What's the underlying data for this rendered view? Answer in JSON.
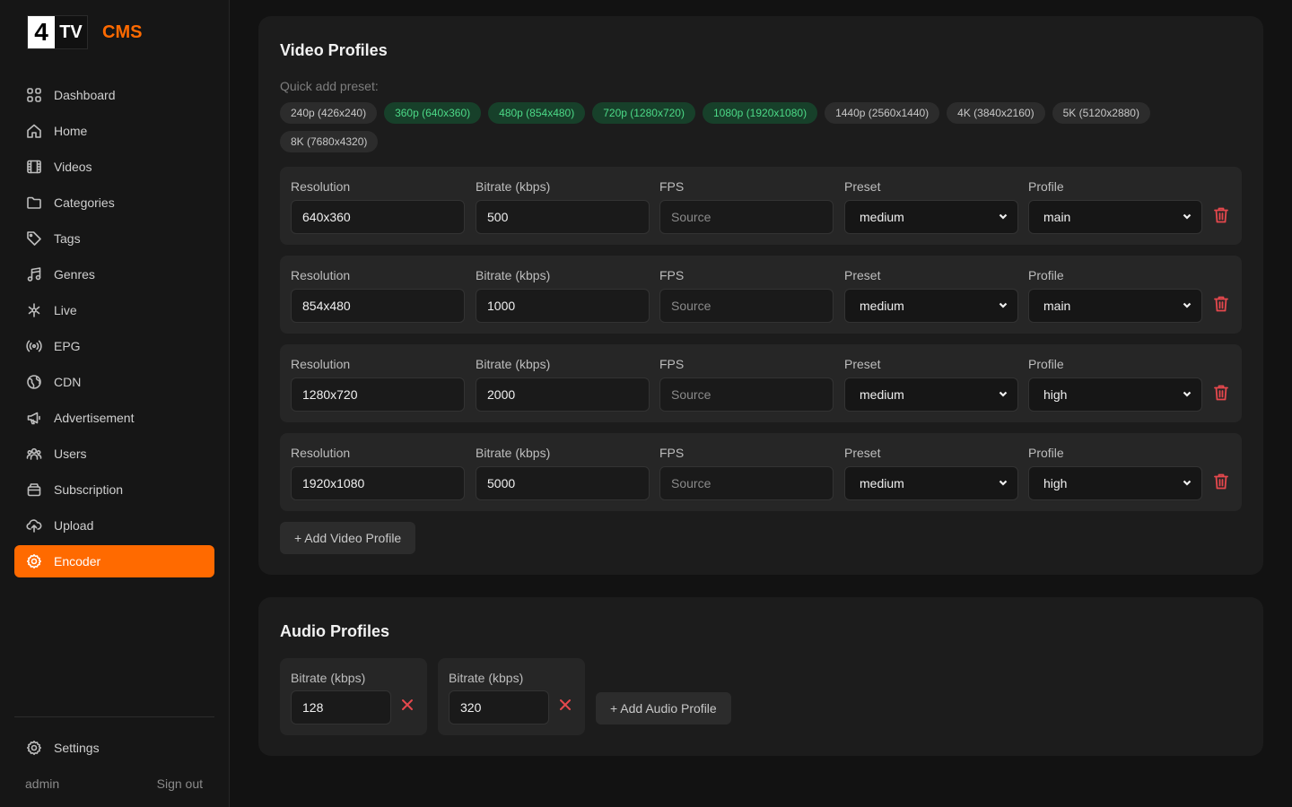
{
  "brand": {
    "logo_num": "4",
    "logo_tv": "TV",
    "logo_cms": "CMS",
    "accent": "#ff6a00"
  },
  "sidebar": {
    "items": [
      {
        "label": "Dashboard",
        "icon": "dashboard-icon"
      },
      {
        "label": "Home",
        "icon": "home-icon"
      },
      {
        "label": "Videos",
        "icon": "film-icon"
      },
      {
        "label": "Categories",
        "icon": "folder-icon"
      },
      {
        "label": "Tags",
        "icon": "tag-icon"
      },
      {
        "label": "Genres",
        "icon": "music-icon"
      },
      {
        "label": "Live",
        "icon": "live-icon"
      },
      {
        "label": "EPG",
        "icon": "broadcast-icon"
      },
      {
        "label": "CDN",
        "icon": "globe-icon"
      },
      {
        "label": "Advertisement",
        "icon": "megaphone-icon"
      },
      {
        "label": "Users",
        "icon": "users-icon"
      },
      {
        "label": "Subscription",
        "icon": "wallet-icon"
      },
      {
        "label": "Upload",
        "icon": "upload-icon"
      },
      {
        "label": "Encoder",
        "icon": "gear-icon",
        "active": true
      }
    ],
    "settings_label": "Settings",
    "user": "admin",
    "signout_label": "Sign out"
  },
  "video": {
    "title": "Video Profiles",
    "quick_label": "Quick add preset:",
    "presets": [
      {
        "label": "240p (426x240)",
        "added": false
      },
      {
        "label": "360p (640x360)",
        "added": true
      },
      {
        "label": "480p (854x480)",
        "added": true
      },
      {
        "label": "720p (1280x720)",
        "added": true
      },
      {
        "label": "1080p (1920x1080)",
        "added": true
      },
      {
        "label": "1440p (2560x1440)",
        "added": false
      },
      {
        "label": "4K (3840x2160)",
        "added": false
      },
      {
        "label": "5K (5120x2880)",
        "added": false
      },
      {
        "label": "8K (7680x4320)",
        "added": false
      }
    ],
    "labels": {
      "resolution": "Resolution",
      "bitrate": "Bitrate (kbps)",
      "fps": "FPS",
      "preset": "Preset",
      "profile": "Profile"
    },
    "fps_placeholder": "Source",
    "profiles": [
      {
        "resolution": "640x360",
        "bitrate": "500",
        "preset": "medium",
        "profile": "main"
      },
      {
        "resolution": "854x480",
        "bitrate": "1000",
        "preset": "medium",
        "profile": "main"
      },
      {
        "resolution": "1280x720",
        "bitrate": "2000",
        "preset": "medium",
        "profile": "high"
      },
      {
        "resolution": "1920x1080",
        "bitrate": "5000",
        "preset": "medium",
        "profile": "high"
      }
    ],
    "add_label": "+ Add Video Profile"
  },
  "audio": {
    "title": "Audio Profiles",
    "bitrate_label": "Bitrate (kbps)",
    "profiles": [
      {
        "bitrate": "128"
      },
      {
        "bitrate": "320"
      }
    ],
    "add_label": "+ Add Audio Profile"
  }
}
